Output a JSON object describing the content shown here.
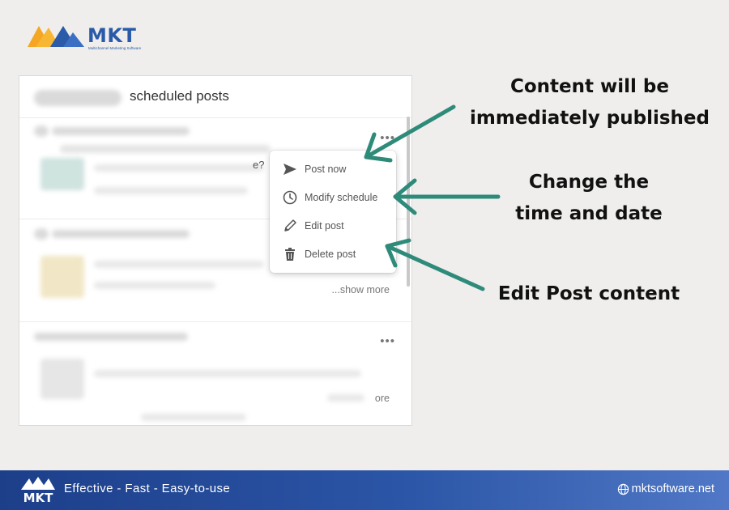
{
  "brand": {
    "name": "MKT",
    "tagline_small": "Multichannel Marketing Software",
    "colors": {
      "primary": "#2a5aa8",
      "accent_orange": "#f5a623",
      "arrow": "#2e8b7a"
    }
  },
  "panel": {
    "title": "scheduled posts",
    "posts": [
      {
        "fragment": "e?",
        "actions_icon": "more-horizontal-icon"
      },
      {
        "show_more": "...show more"
      },
      {
        "show_more": "ore",
        "actions_icon": "more-horizontal-icon"
      }
    ]
  },
  "menu": {
    "items": [
      {
        "label": "Post now",
        "icon": "send-icon"
      },
      {
        "label": "Modify schedule",
        "icon": "clock-icon"
      },
      {
        "label": "Edit post",
        "icon": "pencil-icon"
      },
      {
        "label": "Delete post",
        "icon": "trash-icon"
      }
    ]
  },
  "callouts": {
    "post_now": [
      "Content will be",
      "immediately published"
    ],
    "modify_schedule": [
      "Change the",
      "time and date"
    ],
    "edit_post": [
      "Edit Post content"
    ]
  },
  "footer": {
    "tagline": "Effective - Fast - Easy-to-use",
    "website": "mktsoftware.net"
  }
}
